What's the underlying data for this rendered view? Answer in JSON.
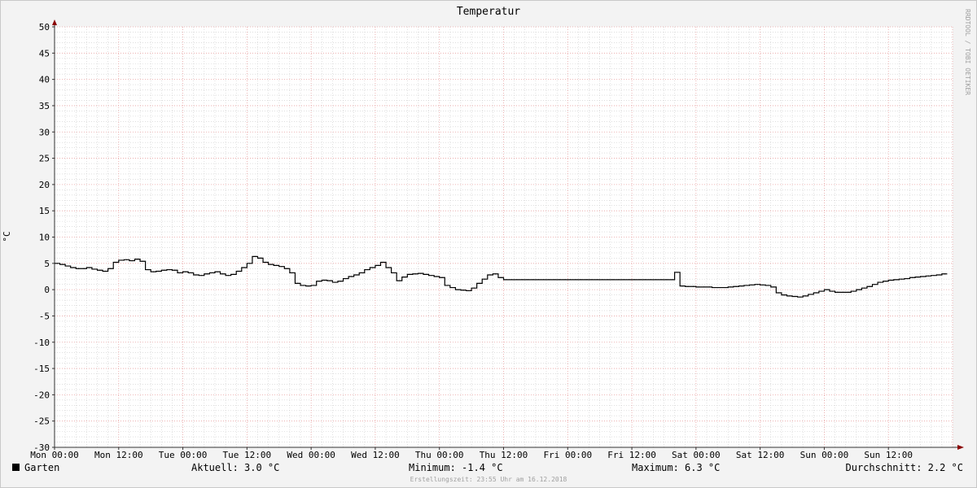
{
  "chart_data": {
    "type": "line",
    "title": "Temperatur",
    "ylabel": "°C",
    "xlabel": "",
    "ylim": [
      -30,
      50
    ],
    "y_ticks": [
      50,
      45,
      40,
      35,
      30,
      25,
      20,
      15,
      10,
      5,
      0,
      -5,
      -10,
      -15,
      -20,
      -25,
      -30
    ],
    "x_ticks": [
      "Mon 00:00",
      "Mon 12:00",
      "Tue 00:00",
      "Tue 12:00",
      "Wed 00:00",
      "Wed 12:00",
      "Thu 00:00",
      "Thu 12:00",
      "Fri 00:00",
      "Fri 12:00",
      "Sat 00:00",
      "Sat 12:00",
      "Sun 00:00",
      "Sun 12:00"
    ],
    "xlim_hours": [
      0,
      168
    ],
    "grid": true,
    "series": [
      {
        "name": "Garten",
        "color": "#000000",
        "x_hours": [
          0,
          1,
          2,
          3,
          4,
          5,
          6,
          7,
          8,
          9,
          10,
          11,
          12,
          13,
          14,
          15,
          16,
          17,
          18,
          19,
          20,
          21,
          22,
          23,
          24,
          25,
          26,
          27,
          28,
          29,
          30,
          31,
          32,
          33,
          34,
          35,
          36,
          37,
          38,
          39,
          40,
          41,
          42,
          43,
          44,
          45,
          46,
          47,
          48,
          49,
          50,
          51,
          52,
          53,
          54,
          55,
          56,
          57,
          58,
          59,
          60,
          61,
          62,
          63,
          64,
          65,
          66,
          67,
          68,
          69,
          70,
          71,
          72,
          73,
          74,
          75,
          76,
          77,
          78,
          79,
          80,
          81,
          82,
          83,
          84,
          85,
          86,
          87,
          88,
          89,
          90,
          91,
          92,
          93,
          94,
          95,
          96,
          97,
          98,
          99,
          100,
          101,
          102,
          103,
          104,
          105,
          106,
          107,
          108,
          109,
          110,
          111,
          112,
          113,
          114,
          115,
          116,
          117,
          118,
          119,
          120,
          121,
          122,
          123,
          124,
          125,
          126,
          127,
          128,
          129,
          130,
          131,
          132,
          133,
          134,
          135,
          136,
          137,
          138,
          139,
          140,
          141,
          142,
          143,
          144,
          145,
          146,
          147,
          148,
          149,
          150,
          151,
          152,
          153,
          154,
          155,
          156,
          157,
          158,
          159,
          160,
          161,
          162,
          163,
          164,
          165,
          166
        ],
        "values": [
          5.0,
          4.8,
          4.5,
          4.2,
          4.0,
          4.0,
          4.2,
          3.9,
          3.7,
          3.5,
          4.0,
          5.2,
          5.6,
          5.7,
          5.5,
          5.8,
          5.4,
          3.8,
          3.4,
          3.5,
          3.7,
          3.8,
          3.7,
          3.2,
          3.4,
          3.2,
          2.8,
          2.7,
          3.0,
          3.2,
          3.4,
          3.0,
          2.7,
          2.9,
          3.5,
          4.2,
          5.0,
          6.3,
          6.0,
          5.2,
          4.8,
          4.6,
          4.4,
          4.0,
          3.2,
          1.2,
          0.8,
          0.7,
          0.8,
          1.6,
          1.8,
          1.7,
          1.4,
          1.6,
          2.1,
          2.5,
          2.8,
          3.2,
          3.8,
          4.2,
          4.6,
          5.2,
          4.2,
          3.2,
          1.7,
          2.4,
          2.9,
          3.0,
          3.1,
          2.9,
          2.7,
          2.5,
          2.3,
          0.8,
          0.4,
          0.0,
          -0.1,
          -0.2,
          0.3,
          1.2,
          2.0,
          2.8,
          3.0,
          2.3,
          1.9,
          1.9,
          1.9,
          1.9,
          1.9,
          1.9,
          1.9,
          1.9,
          1.9,
          1.9,
          1.9,
          1.9,
          1.9,
          1.9,
          1.9,
          1.9,
          1.9,
          1.9,
          1.9,
          1.9,
          1.9,
          1.9,
          1.9,
          1.9,
          1.9,
          1.9,
          1.9,
          1.9,
          1.9,
          1.9,
          1.9,
          1.9,
          3.3,
          0.7,
          0.6,
          0.6,
          0.5,
          0.5,
          0.5,
          0.4,
          0.4,
          0.4,
          0.5,
          0.6,
          0.7,
          0.8,
          0.9,
          1.0,
          0.9,
          0.8,
          0.5,
          -0.6,
          -1.0,
          -1.2,
          -1.3,
          -1.4,
          -1.2,
          -0.9,
          -0.6,
          -0.3,
          0.0,
          -0.3,
          -0.5,
          -0.5,
          -0.5,
          -0.3,
          0.0,
          0.3,
          0.6,
          1.0,
          1.4,
          1.6,
          1.8,
          1.9,
          2.0,
          2.1,
          2.3,
          2.4,
          2.5,
          2.6,
          2.7,
          2.8,
          3.0
        ]
      }
    ],
    "legend": {
      "placement": "bottom-left",
      "series_label": "Garten",
      "current": "Aktuell: 3.0 °C",
      "minimum": "Minimum: -1.4 °C",
      "maximum": "Maximum: 6.3 °C",
      "average": "Durchschnitt: 2.2 °C"
    },
    "footer": "Erstellungszeit: 23:55 Uhr am 16.12.2018",
    "watermark": "RRDTOOL / TOBI OETIKER"
  },
  "colors": {
    "background": "#f3f3f3",
    "canvas": "#ffffff",
    "major_grid": "#e8a0a0",
    "minor_grid": "#cccccc",
    "axis": "#333333",
    "arrow": "#8b0000",
    "line": "#000000",
    "text": "#000000",
    "watermark": "#a0a0a0"
  }
}
